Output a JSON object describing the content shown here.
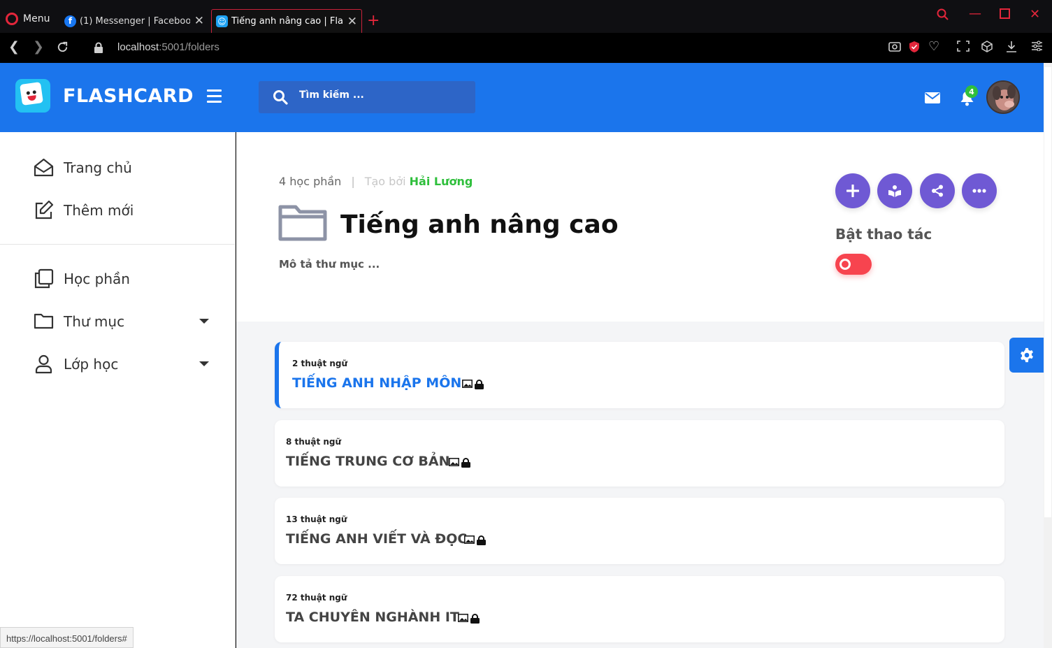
{
  "browser": {
    "menu_label": "Menu",
    "tabs": [
      {
        "title": "(1) Messenger | Facebook",
        "favicon": "facebook-icon"
      },
      {
        "title": "Tiếng anh nâng cao | Flashcard",
        "favicon": "flashcard-icon"
      }
    ],
    "url_host": "localhost",
    "url_path": ":5001/folders",
    "status_url": "https://localhost:5001/folders#",
    "accent_color": "#e3263b"
  },
  "header": {
    "brand": "FLASHCARD",
    "search_placeholder": "Tìm kiếm ...",
    "notification_count": "4",
    "brand_color": "#1b75ec"
  },
  "sidebar": {
    "primary": [
      {
        "label": "Trang chủ",
        "icon": "home-icon"
      },
      {
        "label": "Thêm mới",
        "icon": "edit-icon"
      }
    ],
    "secondary": [
      {
        "label": "Học phần",
        "icon": "copy-icon"
      },
      {
        "label": "Thư mục",
        "icon": "folder-icon",
        "has_dropdown": true
      },
      {
        "label": "Lớp học",
        "icon": "user-icon",
        "has_dropdown": true
      }
    ]
  },
  "folder": {
    "module_count": "4 học phần",
    "created_by_label": "Tạo bởi",
    "author": "Hải Lương",
    "title": "Tiếng anh nâng cao",
    "description": "Mô tả thư mục ...",
    "toggle_label": "Bật thao tác",
    "toggle_on": false,
    "actions": [
      "plus-icon",
      "book-icon",
      "share-icon",
      "more-icon"
    ],
    "action_color": "#6f59d4"
  },
  "modules": [
    {
      "count": "2 thuật ngữ",
      "title": "TIẾNG ANH NHẬP MÔN",
      "active": true
    },
    {
      "count": "8 thuật ngữ",
      "title": "TIẾNG TRUNG CƠ BẢN",
      "active": false
    },
    {
      "count": "13 thuật ngữ",
      "title": "TIẾNG ANH VIẾT VÀ ĐỌC",
      "active": false
    },
    {
      "count": "72 thuật ngữ",
      "title": "TA CHUYÊN NGHÀNH IT",
      "active": false
    }
  ]
}
